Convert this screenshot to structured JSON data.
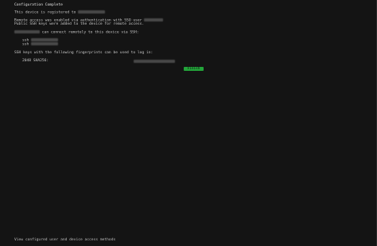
{
  "dialog": {
    "title": "Configuration Complete",
    "registered_prefix": "This device is registered to",
    "remote_access_line": "Remote access was enabled via authentication with SSO user",
    "ssh_keys_added": "Public SSH keys were added to the device for remote access.",
    "connect_suffix": "can connect remotely to this device via SSH:",
    "ssh_cmd_1": "ssh",
    "ssh_cmd_2": "ssh",
    "fingerprints_intro": "SSH keys with the following fingerprints can be used to log in:",
    "fingerprint_label": "2048 SHA256:",
    "finish_label": "Finish"
  },
  "footer": {
    "hint": "View configured user and device access methods"
  }
}
